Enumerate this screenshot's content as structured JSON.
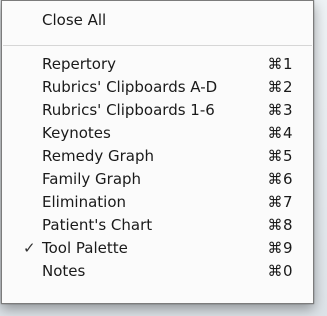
{
  "menu": {
    "close_all": "Close All",
    "items": [
      {
        "label": "Repertory",
        "shortcut": "⌘1",
        "checked": false
      },
      {
        "label": "Rubrics' Clipboards A-D",
        "shortcut": "⌘2",
        "checked": false
      },
      {
        "label": "Rubrics' Clipboards 1-6",
        "shortcut": "⌘3",
        "checked": false
      },
      {
        "label": "Keynotes",
        "shortcut": "⌘4",
        "checked": false
      },
      {
        "label": "Remedy Graph",
        "shortcut": "⌘5",
        "checked": false
      },
      {
        "label": "Family Graph",
        "shortcut": "⌘6",
        "checked": false
      },
      {
        "label": "Elimination",
        "shortcut": "⌘7",
        "checked": false
      },
      {
        "label": "Patient's Chart",
        "shortcut": "⌘8",
        "checked": false
      },
      {
        "label": "Tool Palette",
        "shortcut": "⌘9",
        "checked": true
      },
      {
        "label": "Notes",
        "shortcut": "⌘0",
        "checked": false
      }
    ],
    "check_mark": "✓"
  }
}
